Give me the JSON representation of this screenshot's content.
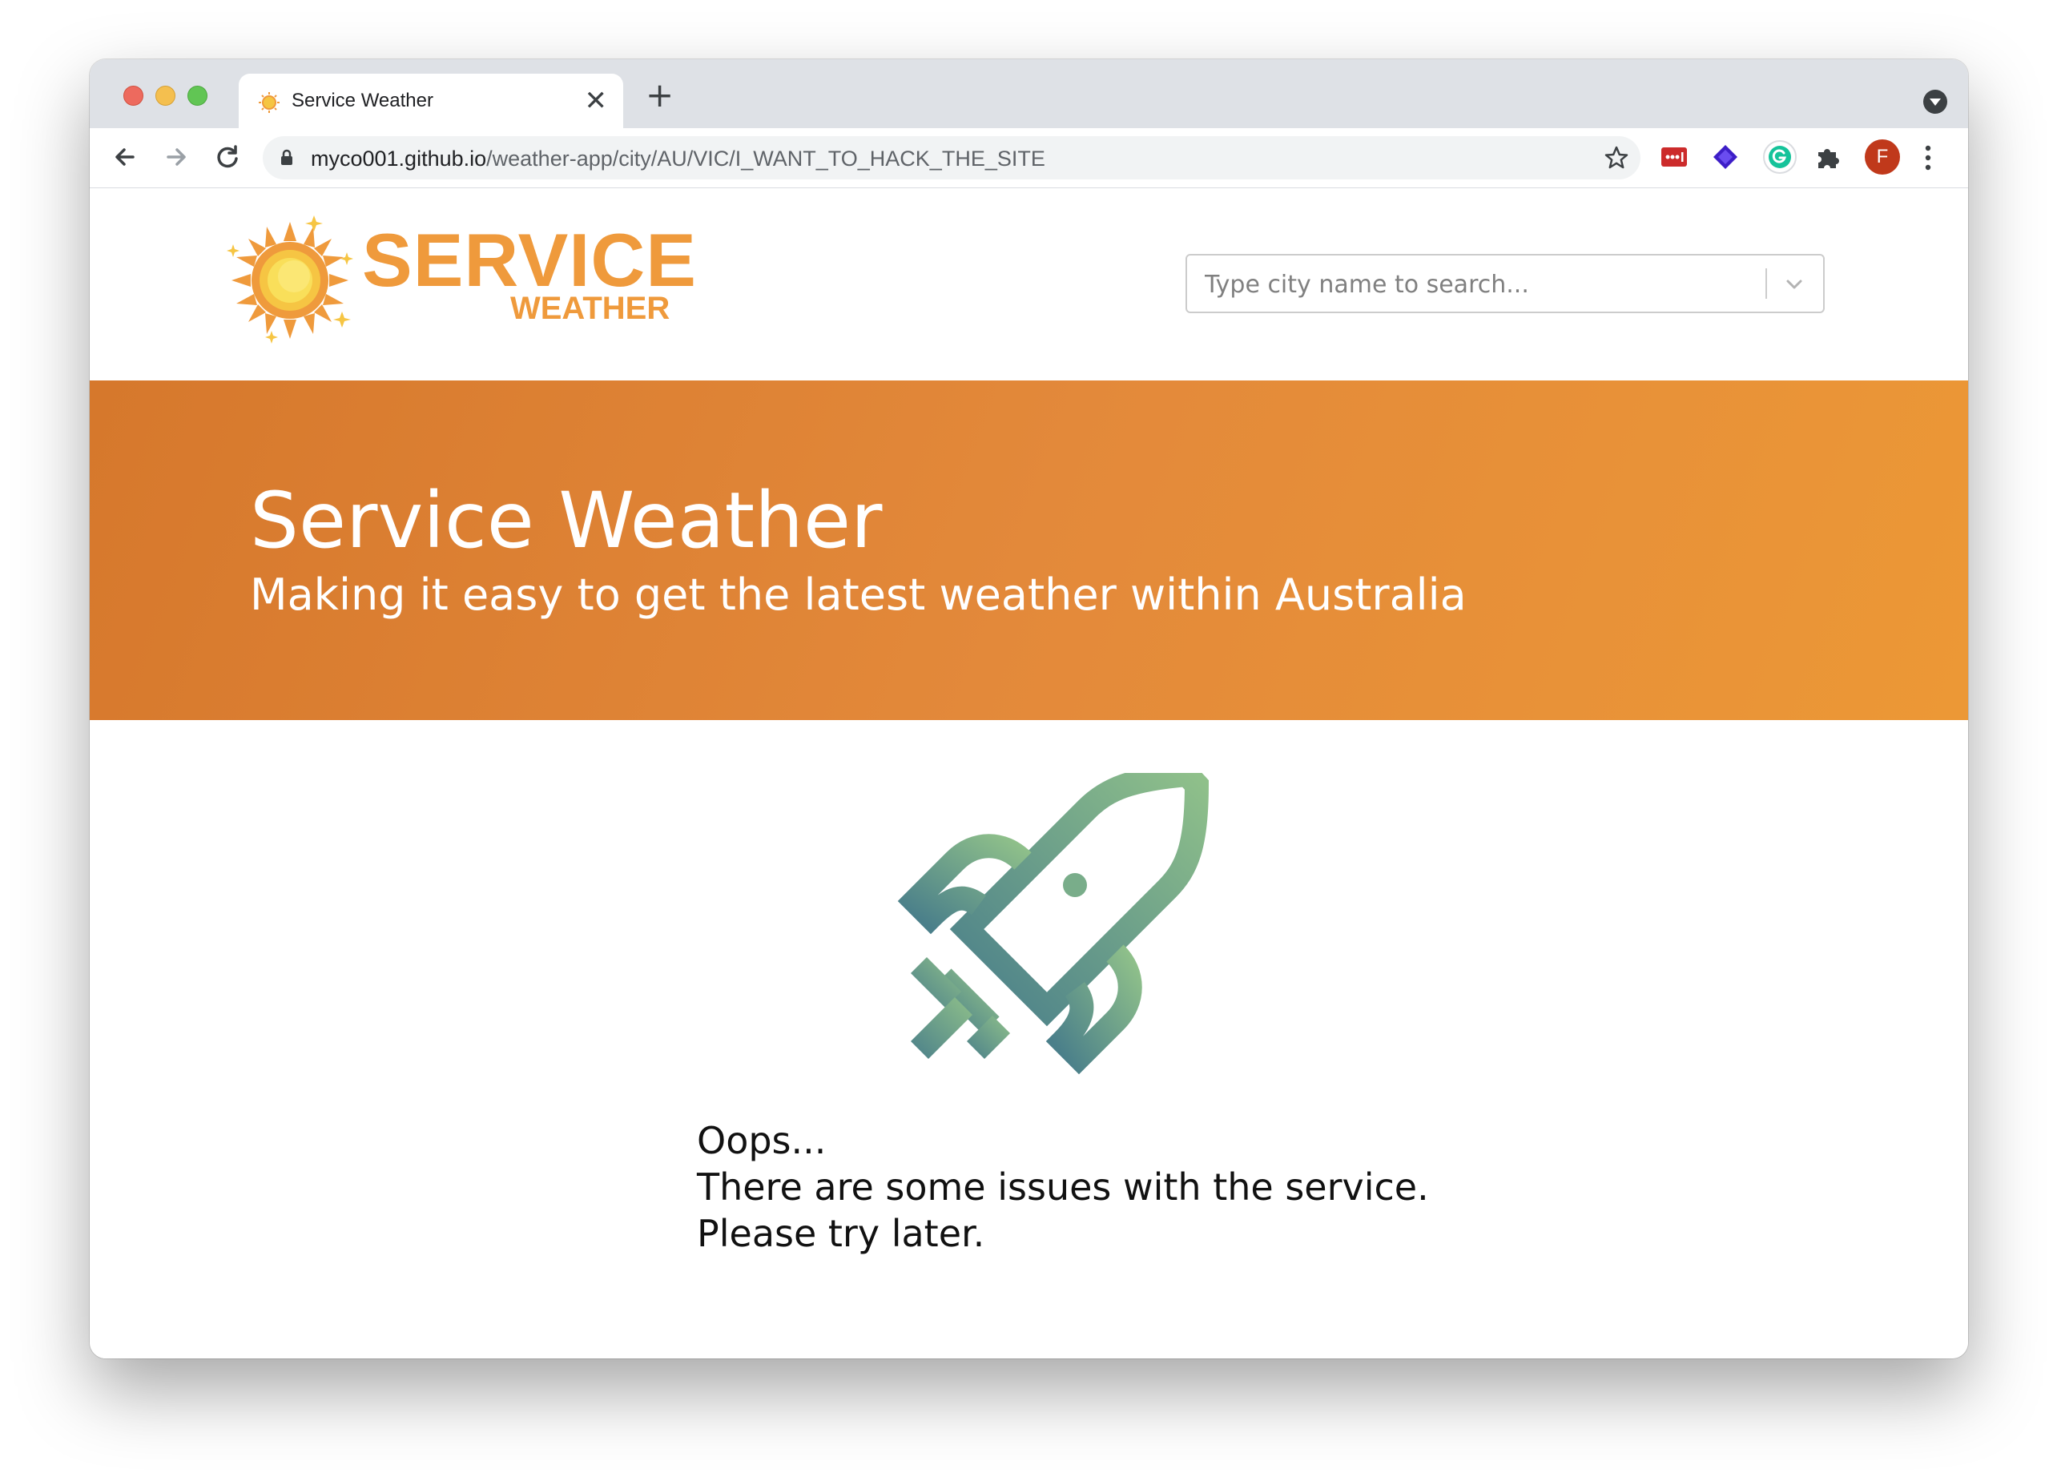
{
  "browser": {
    "tab_title": "Service Weather",
    "tab_close": "✕",
    "new_tab": "+",
    "url_host": "myco001.github.io",
    "url_path": "/weather-app/city/AU/VIC/I_WANT_TO_HACK_THE_SITE",
    "profile_initial": "F",
    "extensions": [
      "lastpass-icon",
      "layers-icon",
      "grammarly-icon",
      "puzzle-icon"
    ]
  },
  "header": {
    "logo_top": "SERVICE",
    "logo_bottom": "WEATHER",
    "search_placeholder": "Type city name to search..."
  },
  "hero": {
    "title": "Service Weather",
    "subtitle": "Making it easy to get the latest weather within Australia"
  },
  "error": {
    "line1": "Oops...",
    "line2": "There are some issues with the service.",
    "line3": "Please try later."
  },
  "colors": {
    "brand_orange": "#ef9a3c",
    "hero_start": "#d6782c",
    "hero_end": "#ec9836",
    "rocket_start": "#4a7f8a",
    "rocket_end": "#8fc08a"
  }
}
